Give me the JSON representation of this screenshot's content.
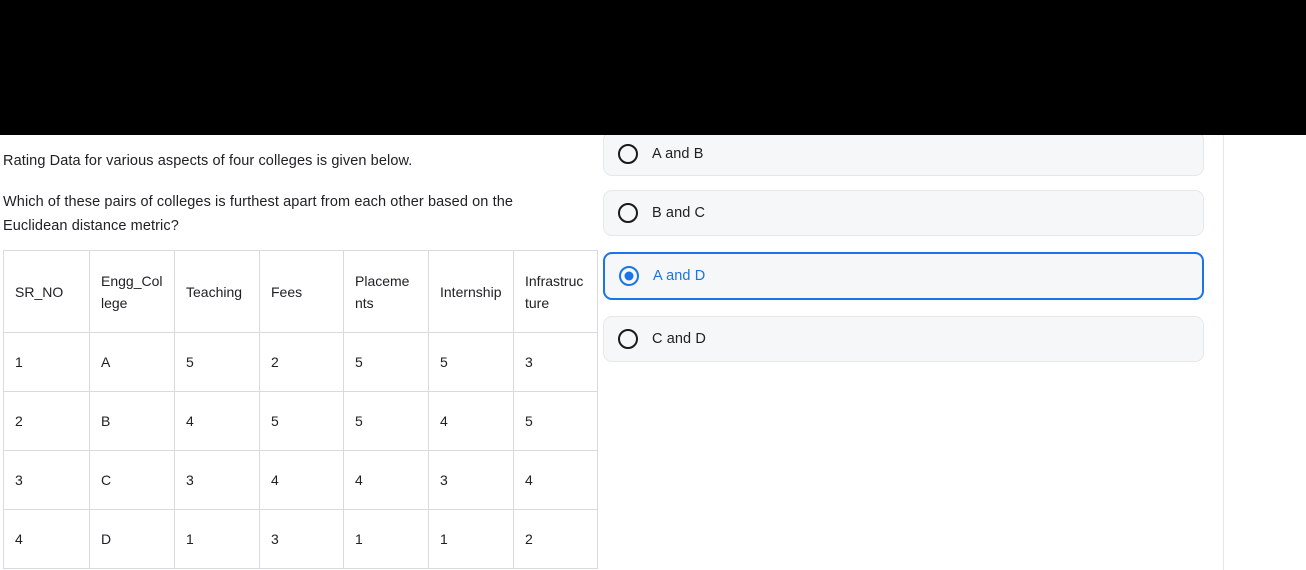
{
  "question": {
    "intro": "Rating Data for various aspects of four colleges is given below.",
    "prompt": "Which of these pairs of colleges is furthest apart from each other based on the Euclidean distance metric?"
  },
  "table": {
    "headers": [
      "SR_NO",
      "Engg_College",
      "Teaching",
      "Fees",
      "Placements",
      "Internship",
      "Infrastructure"
    ],
    "rows": [
      [
        "1",
        "A",
        "5",
        "2",
        "5",
        "5",
        "3"
      ],
      [
        "2",
        "B",
        "4",
        "5",
        "5",
        "4",
        "5"
      ],
      [
        "3",
        "C",
        "3",
        "4",
        "4",
        "3",
        "4"
      ],
      [
        "4",
        "D",
        "1",
        "3",
        "1",
        "1",
        "2"
      ]
    ]
  },
  "options": {
    "selected_index": 2,
    "items": [
      {
        "label": "A and B",
        "selected": false
      },
      {
        "label": "B and C",
        "selected": false
      },
      {
        "label": "A and D",
        "selected": true
      },
      {
        "label": "C and D",
        "selected": false
      }
    ]
  },
  "colors": {
    "accent": "#1a73e8",
    "card_bg": "#f6f7f8",
    "card_border": "#e6e8ea",
    "table_border": "#d7dade",
    "text": "#202124",
    "occlusion": "#000000"
  }
}
